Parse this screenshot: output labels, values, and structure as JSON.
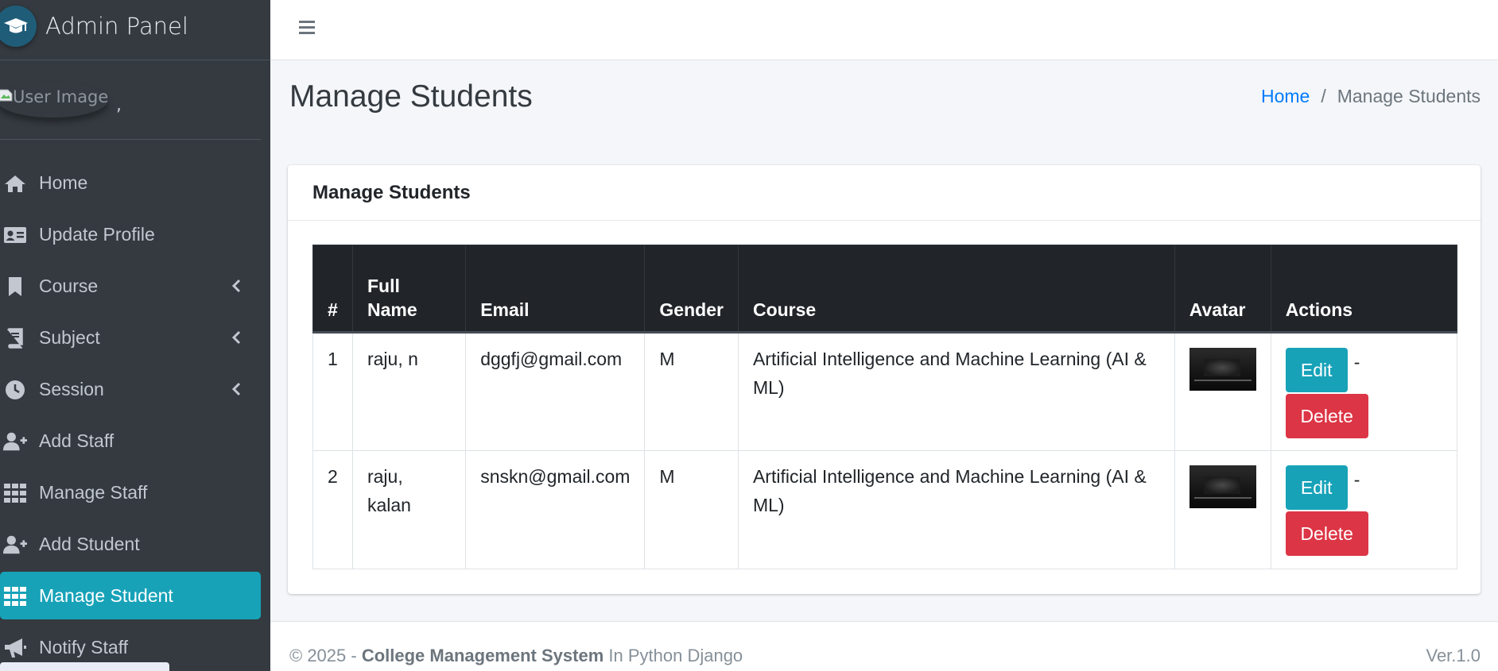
{
  "brand": {
    "title": "Admin Panel"
  },
  "user": {
    "image_alt": "User Image",
    "name": ","
  },
  "sidebar": {
    "items": [
      {
        "label": "Home",
        "icon": "home-icon",
        "has_submenu": false,
        "active": false
      },
      {
        "label": "Update Profile",
        "icon": "id-card-icon",
        "has_submenu": false,
        "active": false
      },
      {
        "label": "Course",
        "icon": "bookmark-icon",
        "has_submenu": true,
        "active": false
      },
      {
        "label": "Subject",
        "icon": "book-icon",
        "has_submenu": true,
        "active": false
      },
      {
        "label": "Session",
        "icon": "clock-icon",
        "has_submenu": true,
        "active": false
      },
      {
        "label": "Add Staff",
        "icon": "user-plus-icon",
        "has_submenu": false,
        "active": false
      },
      {
        "label": "Manage Staff",
        "icon": "grid-icon",
        "has_submenu": false,
        "active": false
      },
      {
        "label": "Add Student",
        "icon": "user-plus-icon",
        "has_submenu": false,
        "active": false
      },
      {
        "label": "Manage Student",
        "icon": "grid-icon",
        "has_submenu": false,
        "active": true
      },
      {
        "label": "Notify Staff",
        "icon": "bullhorn-icon",
        "has_submenu": false,
        "active": false
      }
    ]
  },
  "header": {
    "menu_icon": "hamburger-icon"
  },
  "page": {
    "title": "Manage Students",
    "breadcrumb": {
      "home": "Home",
      "separator": "/",
      "current": "Manage Students"
    }
  },
  "card": {
    "title": "Manage Students",
    "table": {
      "headers": {
        "num": "#",
        "full_name": "Full Name",
        "email": "Email",
        "gender": "Gender",
        "course": "Course",
        "avatar": "Avatar",
        "actions": "Actions"
      },
      "rows": [
        {
          "num": "1",
          "full_name": "raju, n",
          "email": "dggfj@gmail.com",
          "gender": "M",
          "course": "Artificial Intelligence and Machine Learning (AI & ML)",
          "edit": "Edit",
          "sep": "-",
          "delete": "Delete"
        },
        {
          "num": "2",
          "full_name": "raju, kalan",
          "email": "snskn@gmail.com",
          "gender": "M",
          "course": "Artificial Intelligence and Machine Learning (AI & ML)",
          "edit": "Edit",
          "sep": "-",
          "delete": "Delete"
        }
      ]
    }
  },
  "footer": {
    "copyright": "© 2025 -",
    "product": "College Management System",
    "suffix": "In Python Django",
    "version": "Ver.1.0"
  },
  "colors": {
    "sidebar_bg": "#343a40",
    "accent": "#17a2b8",
    "danger": "#dc3545",
    "link": "#007bff",
    "table_head_bg": "#212529"
  }
}
